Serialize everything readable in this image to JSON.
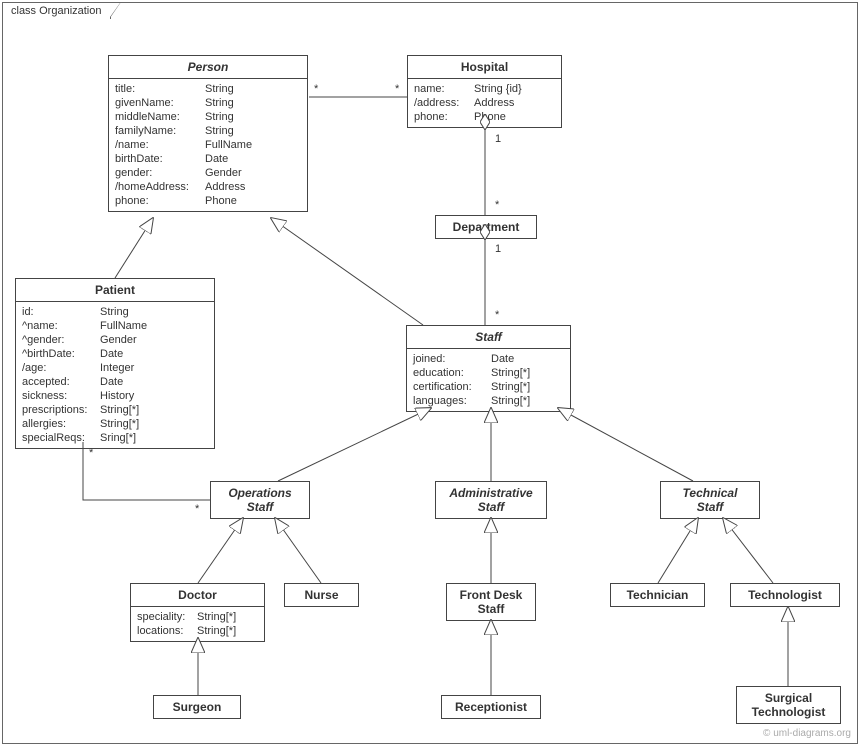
{
  "frame": {
    "title": "class Organization"
  },
  "classes": {
    "person": {
      "name": "Person",
      "attrs": [
        {
          "n": "title:",
          "t": "String"
        },
        {
          "n": "givenName:",
          "t": "String"
        },
        {
          "n": "middleName:",
          "t": "String"
        },
        {
          "n": "familyName:",
          "t": "String"
        },
        {
          "n": "/name:",
          "t": "FullName"
        },
        {
          "n": "birthDate:",
          "t": "Date"
        },
        {
          "n": "gender:",
          "t": "Gender"
        },
        {
          "n": "/homeAddress:",
          "t": "Address"
        },
        {
          "n": "phone:",
          "t": "Phone"
        }
      ]
    },
    "hospital": {
      "name": "Hospital",
      "attrs": [
        {
          "n": "name:",
          "t": "String {id}"
        },
        {
          "n": "/address:",
          "t": "Address"
        },
        {
          "n": "phone:",
          "t": "Phone"
        }
      ]
    },
    "department": {
      "name": "Department"
    },
    "patient": {
      "name": "Patient",
      "attrs": [
        {
          "n": "id:",
          "t": "String"
        },
        {
          "n": "^name:",
          "t": "FullName"
        },
        {
          "n": "^gender:",
          "t": "Gender"
        },
        {
          "n": "^birthDate:",
          "t": "Date"
        },
        {
          "n": "/age:",
          "t": "Integer"
        },
        {
          "n": "accepted:",
          "t": "Date"
        },
        {
          "n": "sickness:",
          "t": "History"
        },
        {
          "n": "prescriptions:",
          "t": "String[*]"
        },
        {
          "n": "allergies:",
          "t": "String[*]"
        },
        {
          "n": "specialReqs:",
          "t": "Sring[*]"
        }
      ]
    },
    "staff": {
      "name": "Staff",
      "attrs": [
        {
          "n": "joined:",
          "t": "Date"
        },
        {
          "n": "education:",
          "t": "String[*]"
        },
        {
          "n": "certification:",
          "t": "String[*]"
        },
        {
          "n": "languages:",
          "t": "String[*]"
        }
      ]
    },
    "operationsStaff": {
      "name1": "Operations",
      "name2": "Staff"
    },
    "administrativeStaff": {
      "name1": "Administrative",
      "name2": "Staff"
    },
    "technicalStaff": {
      "name1": "Technical",
      "name2": "Staff"
    },
    "doctor": {
      "name": "Doctor",
      "attrs": [
        {
          "n": "speciality:",
          "t": "String[*]"
        },
        {
          "n": "locations:",
          "t": "String[*]"
        }
      ]
    },
    "nurse": {
      "name": "Nurse"
    },
    "frontDeskStaff": {
      "name1": "Front Desk",
      "name2": "Staff"
    },
    "receptionist": {
      "name": "Receptionist"
    },
    "technician": {
      "name": "Technician"
    },
    "technologist": {
      "name": "Technologist"
    },
    "surgeon": {
      "name": "Surgeon"
    },
    "surgicalTechnologist": {
      "name1": "Surgical",
      "name2": "Technologist"
    }
  },
  "mult": {
    "personHospL": "*",
    "personHospR": "*",
    "hospDept1": "1",
    "hospDeptStar": "*",
    "deptStaff1": "1",
    "deptStaffStar": "*",
    "patientOpsStar1": "*",
    "patientOpsStar2": "*"
  },
  "watermark": "© uml-diagrams.org"
}
